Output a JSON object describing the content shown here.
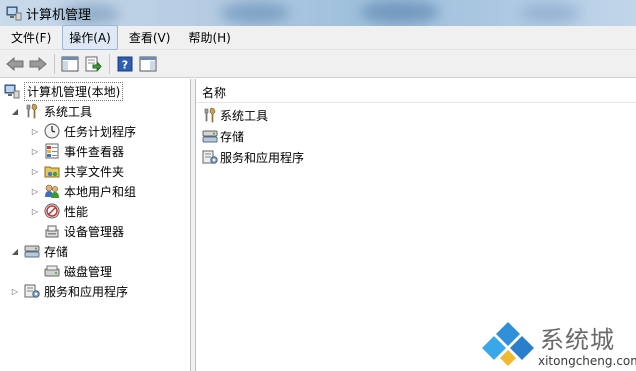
{
  "window": {
    "title": "计算机管理"
  },
  "menu": {
    "items": [
      {
        "label": "文件(F)"
      },
      {
        "label": "操作(A)",
        "active": true
      },
      {
        "label": "查看(V)"
      },
      {
        "label": "帮助(H)"
      }
    ]
  },
  "toolbar": {
    "buttons": [
      "back-arrow-icon",
      "forward-arrow-icon",
      "show-hide-console-tree-icon",
      "export-list-icon",
      "help-icon",
      "action-pane-icon"
    ]
  },
  "tree": {
    "root": {
      "label": "计算机管理(本地)"
    },
    "system_tools": {
      "label": "系统工具"
    },
    "task_scheduler": {
      "label": "任务计划程序"
    },
    "event_viewer": {
      "label": "事件查看器"
    },
    "shared_folders": {
      "label": "共享文件夹"
    },
    "local_users": {
      "label": "本地用户和组"
    },
    "performance": {
      "label": "性能"
    },
    "device_manager": {
      "label": "设备管理器"
    },
    "storage": {
      "label": "存储"
    },
    "disk_management": {
      "label": "磁盘管理"
    },
    "services_apps": {
      "label": "服务和应用程序"
    }
  },
  "list": {
    "column_header": "名称",
    "items": [
      {
        "label": "系统工具",
        "icon": "tools-icon"
      },
      {
        "label": "存储",
        "icon": "storage-icon"
      },
      {
        "label": "服务和应用程序",
        "icon": "services-icon"
      }
    ]
  },
  "watermark": {
    "brand": "系统城",
    "url": "xitongcheng.com"
  }
}
